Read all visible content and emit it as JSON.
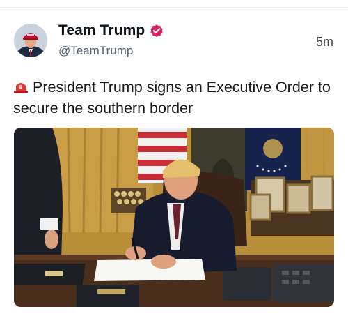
{
  "post": {
    "author_name": "Team Trump",
    "handle": "@TeamTrump",
    "timestamp": "5m",
    "text": "President Trump signs an Executive Order to secure the southern border"
  },
  "icons": {
    "verified": "verified-badge-icon",
    "siren": "police-siren-icon"
  },
  "colors": {
    "verified_badge": "#e0245e",
    "text_primary": "#0f1419",
    "text_secondary": "#556270"
  }
}
